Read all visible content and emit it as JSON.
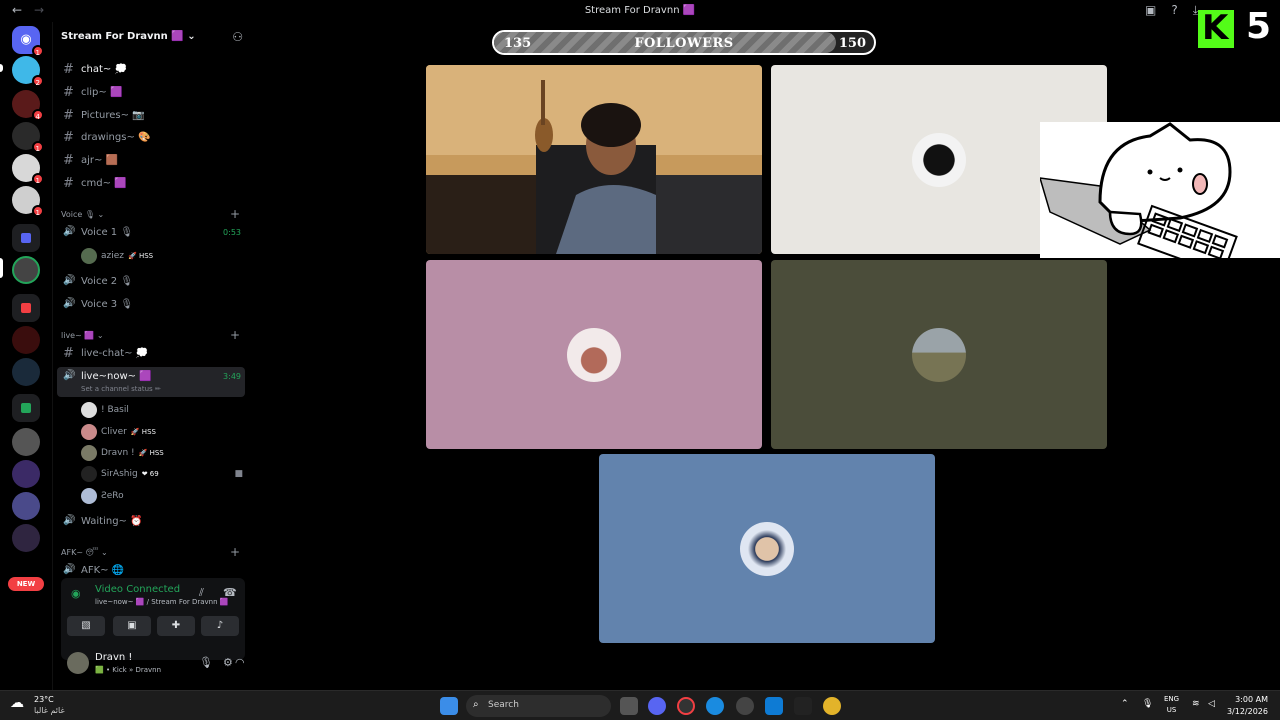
{
  "window": {
    "title": "Stream For Dravnn 🟪"
  },
  "server": {
    "name": "Stream For Dravnn 🟪"
  },
  "rail": {
    "badges": [
      "1",
      "2",
      "4",
      "1",
      "1",
      "1"
    ],
    "new_label": "NEW"
  },
  "text_channels": [
    {
      "label": "chat~ 💭"
    },
    {
      "label": "clip~ 🟪"
    },
    {
      "label": "Pictures~ 📷"
    },
    {
      "label": "drawings~ 🎨"
    },
    {
      "label": "ajr~ 🟫"
    },
    {
      "label": "cmd~ 🟪"
    }
  ],
  "voice_category": {
    "label": "Voice 🎙"
  },
  "voice_channels": [
    {
      "label": "Voice 1 🎙",
      "time": "0:53"
    },
    {
      "label": "Voice 2 🎙"
    },
    {
      "label": "Voice 3 🎙"
    }
  ],
  "voice1_users": [
    {
      "name": "aziez",
      "tag": "🚀 HSS"
    }
  ],
  "live_category": {
    "label": "live~ 🟪"
  },
  "live_channels": {
    "chat": "live-chat~ 💭",
    "now": "live~now~ 🟪",
    "now_time": "3:49",
    "now_status": "Set a channel status ✏"
  },
  "live_users": [
    {
      "name": "! Basil",
      "tag": ""
    },
    {
      "name": "Cliver",
      "tag": "🚀 HSS"
    },
    {
      "name": "Dravn !",
      "tag": "🚀 HSS"
    },
    {
      "name": "SirAshig",
      "tag": "❤ 69"
    },
    {
      "name": "ƧeRo",
      "tag": ""
    }
  ],
  "waiting_channel": {
    "label": "Waiting~ ⏰"
  },
  "afk_category": {
    "label": "AFK~ 😴"
  },
  "afk_channel": {
    "label": "AFK~ 🌐"
  },
  "voice_panel": {
    "status": "Video Connected",
    "location": "live~now~ 🟪 / Stream For Dravnn 🟪"
  },
  "user_panel": {
    "name": "Dravn !",
    "status": "🟩 • Kick » Dravnn"
  },
  "followers_widget": {
    "current": "135",
    "label": "FOLLOWERS",
    "goal": "150",
    "progress_fraction": 0.9
  },
  "kick_overlay": {
    "letter": "K",
    "number": "5"
  },
  "tiles": [
    {
      "kind": "camera",
      "bg": "#c79a5c"
    },
    {
      "kind": "avatar",
      "bg": "#e8e6e1"
    },
    {
      "kind": "avatar",
      "bg": "#b88ea6"
    },
    {
      "kind": "avatar",
      "bg": "#4b4d3a"
    },
    {
      "kind": "avatar",
      "bg": "#6283ad"
    }
  ],
  "taskbar": {
    "temp": "23°C",
    "weather_desc": "غائم غالبا",
    "search_placeholder": "Search",
    "lang_top": "ENG",
    "lang_bottom": "US",
    "time": "3:00 AM",
    "date": "3/12/2026"
  },
  "colors": {
    "discord_blurple": "#5865f2",
    "online_green": "#23a55a",
    "kick_green": "#53fc18",
    "alert_red": "#f23f43"
  }
}
